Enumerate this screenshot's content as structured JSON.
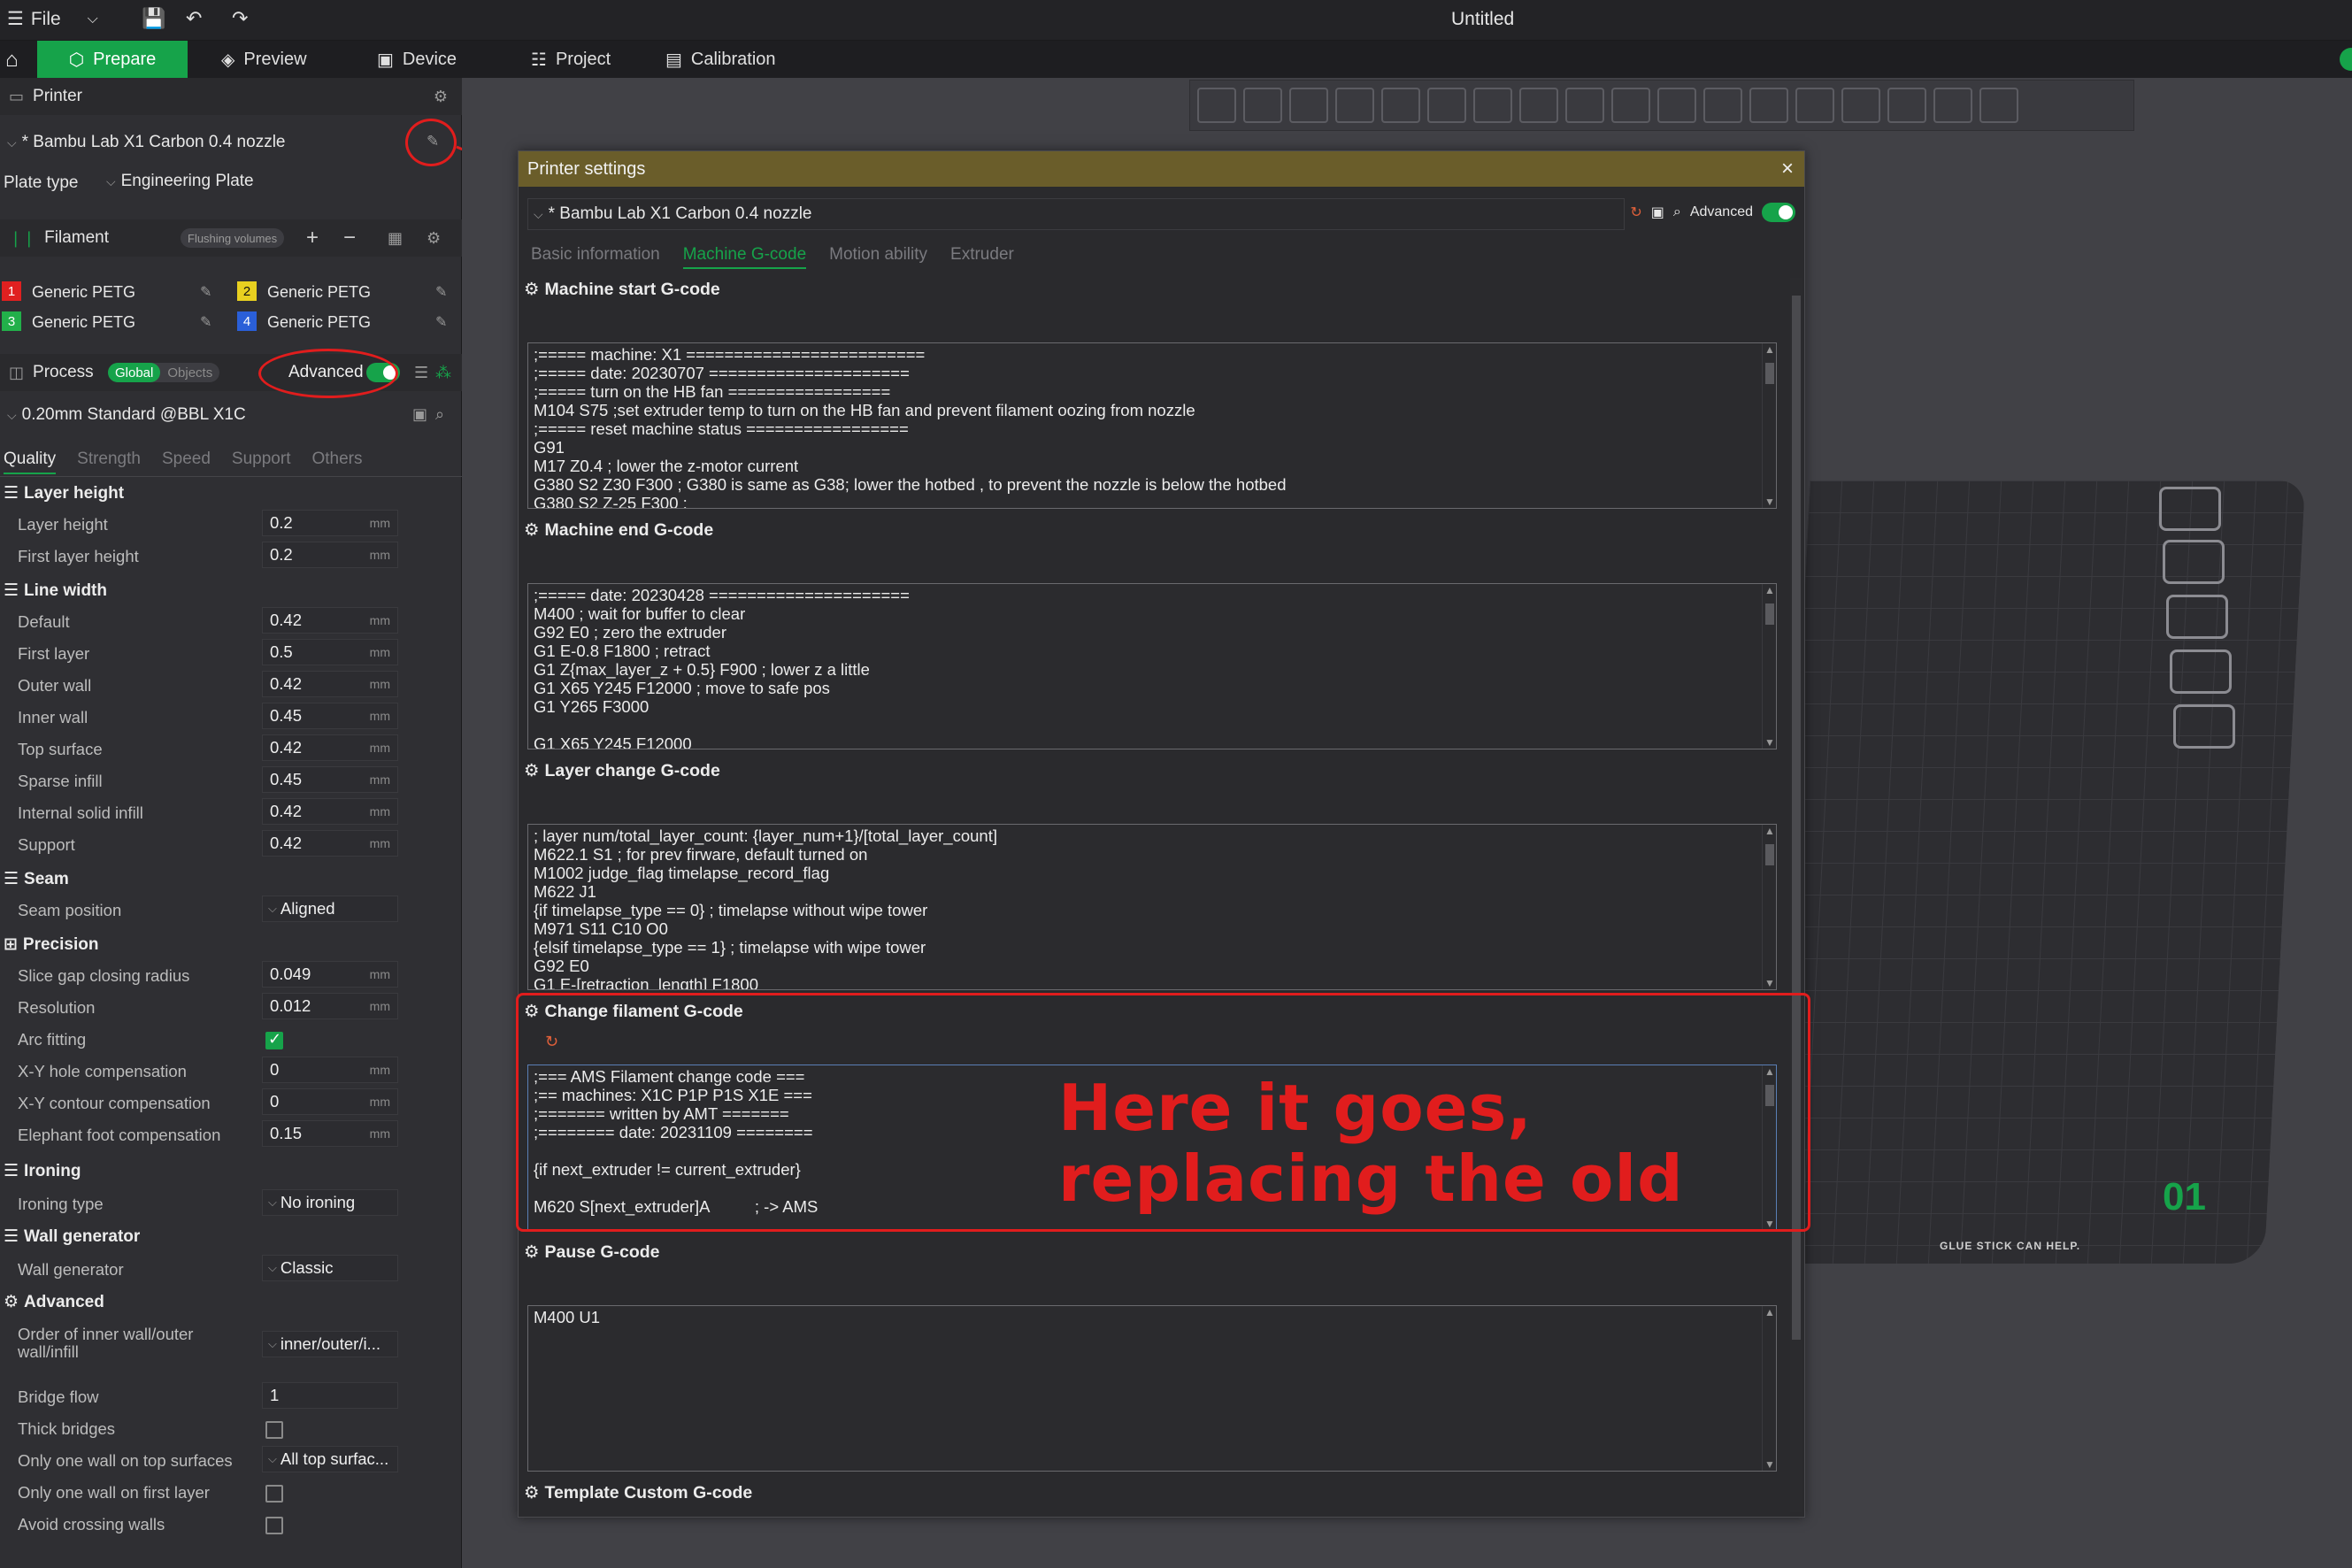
{
  "window": {
    "file_label": "File",
    "title": "Untitled"
  },
  "nav": {
    "tabs": [
      {
        "label": "Prepare",
        "icon": "cube-icon"
      },
      {
        "label": "Preview",
        "icon": "layers-icon"
      },
      {
        "label": "Device",
        "icon": "device-icon"
      },
      {
        "label": "Project",
        "icon": "project-icon"
      },
      {
        "label": "Calibration",
        "icon": "calibration-icon"
      }
    ]
  },
  "printer": {
    "section_label": "Printer",
    "preset": "* Bambu Lab X1 Carbon 0.4 nozzle",
    "plate_type_label": "Plate type",
    "plate_type": "Engineering Plate"
  },
  "filament": {
    "section_label": "Filament",
    "flushing_label": "Flushing volumes",
    "slots": [
      {
        "num": "1",
        "name": "Generic PETG",
        "color": "#e02020"
      },
      {
        "num": "2",
        "name": "Generic PETG",
        "color": "#e8d020"
      },
      {
        "num": "3",
        "name": "Generic PETG",
        "color": "#22b04a"
      },
      {
        "num": "4",
        "name": "Generic PETG",
        "color": "#2a5fd8"
      }
    ]
  },
  "process": {
    "section_label": "Process",
    "global_label": "Global",
    "objects_label": "Objects",
    "advanced_label": "Advanced",
    "preset": "0.20mm Standard @BBL X1C",
    "tabs": [
      "Quality",
      "Strength",
      "Speed",
      "Support",
      "Others"
    ],
    "groups": {
      "layer_height": "Layer height",
      "line_width": "Line width",
      "seam": "Seam",
      "precision": "Precision",
      "ironing": "Ironing",
      "wall_generator": "Wall generator",
      "advanced": "Advanced"
    },
    "params": {
      "layer_height": {
        "label": "Layer height",
        "value": "0.2",
        "unit": "mm"
      },
      "first_layer_height": {
        "label": "First layer height",
        "value": "0.2",
        "unit": "mm"
      },
      "lw_default": {
        "label": "Default",
        "value": "0.42",
        "unit": "mm"
      },
      "lw_first_layer": {
        "label": "First layer",
        "value": "0.5",
        "unit": "mm"
      },
      "lw_outer_wall": {
        "label": "Outer wall",
        "value": "0.42",
        "unit": "mm"
      },
      "lw_inner_wall": {
        "label": "Inner wall",
        "value": "0.45",
        "unit": "mm"
      },
      "lw_top_surface": {
        "label": "Top surface",
        "value": "0.42",
        "unit": "mm"
      },
      "lw_sparse_infill": {
        "label": "Sparse infill",
        "value": "0.45",
        "unit": "mm"
      },
      "lw_internal_solid": {
        "label": "Internal solid infill",
        "value": "0.42",
        "unit": "mm"
      },
      "lw_support": {
        "label": "Support",
        "value": "0.42",
        "unit": "mm"
      },
      "seam_position": {
        "label": "Seam position",
        "value": "Aligned"
      },
      "slice_gap": {
        "label": "Slice gap closing radius",
        "value": "0.049",
        "unit": "mm"
      },
      "resolution": {
        "label": "Resolution",
        "value": "0.012",
        "unit": "mm"
      },
      "arc_fitting": {
        "label": "Arc fitting"
      },
      "xy_hole": {
        "label": "X-Y hole compensation",
        "value": "0",
        "unit": "mm"
      },
      "xy_contour": {
        "label": "X-Y contour compensation",
        "value": "0",
        "unit": "mm"
      },
      "elephant_foot": {
        "label": "Elephant foot compensation",
        "value": "0.15",
        "unit": "mm"
      },
      "ironing_type": {
        "label": "Ironing type",
        "value": "No ironing"
      },
      "wall_generator": {
        "label": "Wall generator",
        "value": "Classic"
      },
      "wall_order": {
        "label": "Order of inner wall/outer wall/infill",
        "value": "inner/outer/i..."
      },
      "bridge_flow": {
        "label": "Bridge flow",
        "value": "1"
      },
      "thick_bridges": {
        "label": "Thick bridges"
      },
      "one_wall_top": {
        "label": "Only one wall on top surfaces",
        "value": "All top surfac..."
      },
      "one_wall_first": {
        "label": "Only one wall on first layer"
      },
      "avoid_crossing": {
        "label": "Avoid crossing walls"
      }
    }
  },
  "viewport": {
    "plate_number": "01",
    "plate_label": "GLUE STICK CAN HELP."
  },
  "dialog": {
    "title": "Printer settings",
    "preset": "* Bambu Lab X1 Carbon 0.4 nozzle",
    "advanced_label": "Advanced",
    "tabs": [
      "Basic information",
      "Machine G-code",
      "Motion ability",
      "Extruder"
    ],
    "sections": {
      "start": {
        "title": "Machine start G-code",
        "code": ";===== machine: X1 =========================\n;===== date: 20230707 =====================\n;===== turn on the HB fan =================\nM104 S75 ;set extruder temp to turn on the HB fan and prevent filament oozing from nozzle\n;===== reset machine status =================\nG91\nM17 Z0.4 ; lower the z-motor current\nG380 S2 Z30 F300 ; G380 is same as G38; lower the hotbed , to prevent the nozzle is below the hotbed\nG380 S2 Z-25 F300 ;"
      },
      "end": {
        "title": "Machine end G-code",
        "code": ";===== date: 20230428 =====================\nM400 ; wait for buffer to clear\nG92 E0 ; zero the extruder\nG1 E-0.8 F1800 ; retract\nG1 Z{max_layer_z + 0.5} F900 ; lower z a little\nG1 X65 Y245 F12000 ; move to safe pos\nG1 Y265 F3000\n\nG1 X65 Y245 F12000"
      },
      "layer": {
        "title": "Layer change G-code",
        "code": "; layer num/total_layer_count: {layer_num+1}/[total_layer_count]\nM622.1 S1 ; for prev firware, default turned on\nM1002 judge_flag timelapse_record_flag\nM622 J1\n{if timelapse_type == 0} ; timelapse without wipe tower\nM971 S11 C10 O0\n{elsif timelapse_type == 1} ; timelapse with wipe tower\nG92 E0\nG1 E-[retraction_length] F1800"
      },
      "filament": {
        "title": "Change filament G-code",
        "code": ";=== AMS Filament change code ===\n;== machines: X1C P1P P1S X1E ===\n;======= written by AMT =======\n;======== date: 20231109 ========\n\n{if next_extruder != current_extruder}\n\nM620 S[next_extruder]A          ; -> AMS"
      },
      "pause": {
        "title": "Pause G-code",
        "code": "M400 U1"
      },
      "template": {
        "title": "Template Custom G-code"
      }
    }
  },
  "annotation": {
    "line1": "Here it goes,",
    "line2": "replacing the old",
    "color": "#e11d1d"
  }
}
